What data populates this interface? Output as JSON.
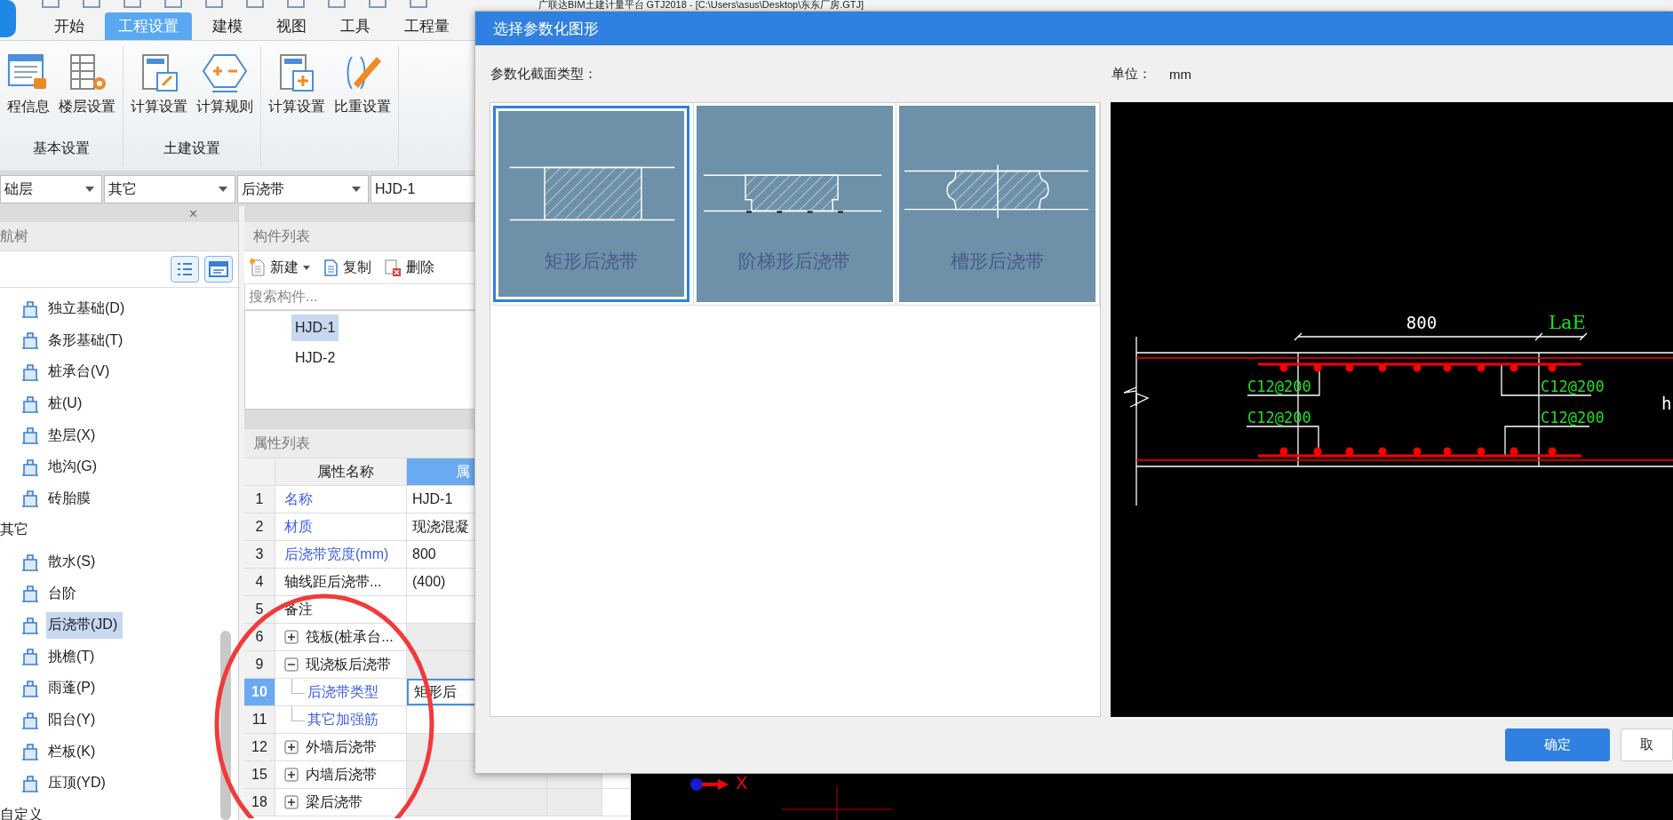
{
  "window": {
    "title": "广联达BIM土建计量平台 GTJ2018 - [C:\\Users\\asus\\Desktop\\东东厂房.GTJ]"
  },
  "ribbon": {
    "tabs": [
      {
        "label": "开始",
        "selected": false
      },
      {
        "label": "工程设置",
        "selected": true
      },
      {
        "label": "建模",
        "selected": false
      },
      {
        "label": "视图",
        "selected": false
      },
      {
        "label": "工具",
        "selected": false
      },
      {
        "label": "工程量",
        "selected": false
      }
    ],
    "groups": [
      {
        "label": "基本设置",
        "buttons": [
          "程信息",
          "楼层设置"
        ]
      },
      {
        "label": "土建设置",
        "buttons": [
          "计算设置",
          "计算规则"
        ]
      },
      {
        "buttons": [
          "计算设置",
          "比重设置"
        ]
      }
    ]
  },
  "filters": [
    "础层",
    "其它",
    "后浇带",
    "HJD-1"
  ],
  "nav_tree": {
    "title": "航树",
    "close": "×",
    "items": [
      {
        "children": [
          {
            "label": "独立基础(D)",
            "selected": false
          },
          {
            "label": "条形基础(T)",
            "selected": false
          },
          {
            "label": "桩承台(V)",
            "selected": false
          },
          {
            "label": "桩(U)",
            "selected": false
          },
          {
            "label": "垫层(X)",
            "selected": false
          },
          {
            "label": "地沟(G)",
            "selected": false
          },
          {
            "label": "砖胎膜",
            "selected": false
          }
        ]
      },
      {
        "label": "其它",
        "children": [
          {
            "label": "散水(S)",
            "selected": false
          },
          {
            "label": "台阶",
            "selected": false
          },
          {
            "label": "后浇带(JD)",
            "selected": true
          },
          {
            "label": "挑檐(T)",
            "selected": false
          },
          {
            "label": "雨蓬(P)",
            "selected": false
          },
          {
            "label": "阳台(Y)",
            "selected": false
          },
          {
            "label": "栏板(K)",
            "selected": false
          },
          {
            "label": "压顶(YD)",
            "selected": false
          }
        ]
      },
      {
        "label": "自定义"
      }
    ]
  },
  "component_list": {
    "title": "构件列表",
    "actions": [
      {
        "label": "新建",
        "menu": true
      },
      {
        "label": "复制",
        "menu": false
      },
      {
        "label": "删除",
        "menu": false
      }
    ],
    "search": {
      "placeholder": "搜索构件..."
    },
    "items": [
      {
        "label": "HJD-1",
        "selected": true
      },
      {
        "label": "HJD-2",
        "selected": false
      }
    ]
  },
  "properties": {
    "title": "属性列表",
    "columns": [
      "属性名称",
      "属"
    ],
    "rows": [
      {
        "num": "1",
        "name": "名称",
        "value": "HJD-1",
        "kind": "public",
        "selected": false
      },
      {
        "num": "2",
        "name": "材质",
        "value": "现浇混凝",
        "kind": "public",
        "selected": false
      },
      {
        "num": "3",
        "name": "后浇带宽度(mm)",
        "value": "800",
        "kind": "public",
        "selected": false
      },
      {
        "num": "4",
        "name": "轴线距后浇带...",
        "value": "(400)",
        "kind": "private",
        "selected": false
      },
      {
        "num": "5",
        "name": "备注",
        "kind": "private",
        "selected": false
      },
      {
        "num": "6",
        "name": "筏板(桩承台...",
        "kind": "group",
        "expanded": false,
        "selected": false
      },
      {
        "num": "9",
        "name": "现浇板后浇带",
        "kind": "group",
        "expanded": true,
        "selected": false,
        "children": [
          {
            "num": "10",
            "name": "后浇带类型",
            "value": "矩形后",
            "kind": "public",
            "selected": true
          },
          {
            "num": "11",
            "name": "其它加强筋",
            "kind": "public",
            "selected": false
          }
        ]
      },
      {
        "num": "12",
        "name": "外墙后浇带",
        "kind": "group",
        "expanded": false,
        "selected": false
      },
      {
        "num": "15",
        "name": "内墙后浇带",
        "kind": "group",
        "expanded": false,
        "selected": false
      },
      {
        "num": "18",
        "name": "梁后浇带",
        "kind": "group",
        "expanded": false,
        "selected": false
      }
    ]
  },
  "dialog": {
    "title": "选择参数化图形",
    "section_label": "参数化截面类型：",
    "unit_label": "单位：",
    "unit_value": "mm",
    "shapes": [
      {
        "label": "矩形后浇带",
        "kind": "rect",
        "selected": true
      },
      {
        "label": "阶梯形后浇带",
        "kind": "step",
        "selected": false
      },
      {
        "label": "槽形后浇带",
        "kind": "groove",
        "selected": false
      }
    ],
    "preview": {
      "width_label": "800",
      "anchor_label": "LaE",
      "rebar_labels": [
        "C12@200",
        "C12@200",
        "C12@200",
        "C12@200"
      ],
      "height_label": "h"
    },
    "buttons": [
      {
        "label": "确定",
        "primary": true
      },
      {
        "label": "取",
        "primary": false
      }
    ]
  },
  "canvas": {
    "axis_label": "X"
  }
}
